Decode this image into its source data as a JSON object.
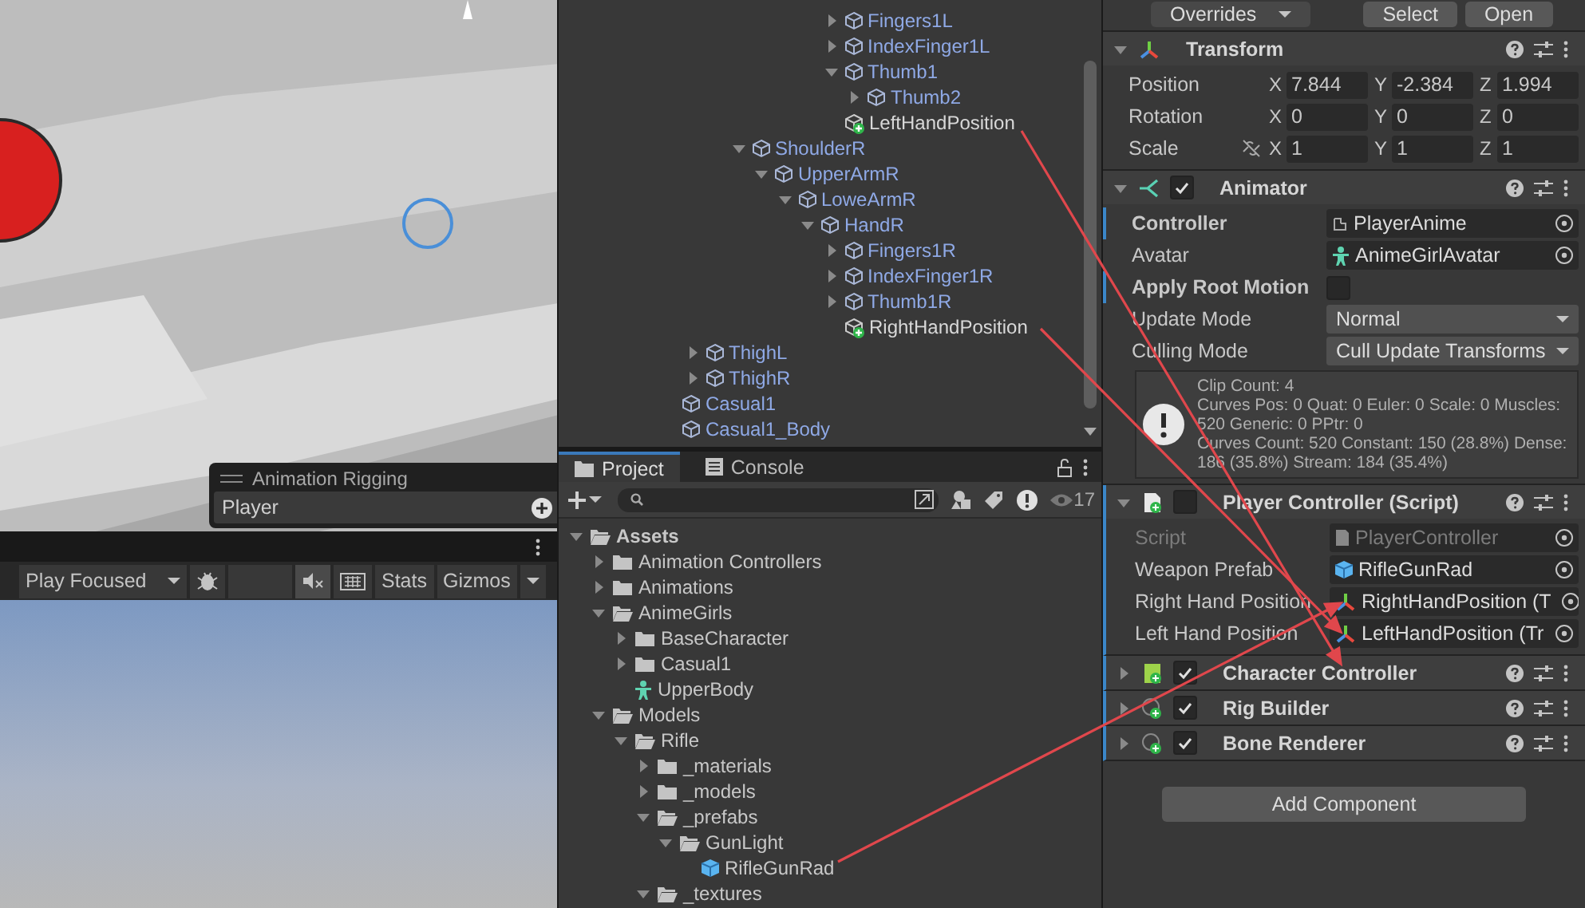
{
  "scene": {
    "overlay": {
      "title": "Animation Rigging",
      "value": "Player"
    }
  },
  "game_toolbar": {
    "play_mode": "Play Focused",
    "stats": "Stats",
    "gizmos": "Gizmos"
  },
  "hierarchy": {
    "items": [
      {
        "children": [
          {
            "children": [
              {
                "children": [
                  {
                    "children": [
                      {
                        "children": [
                          {
                            "children": [
                              {
                                "children": [
                                  {
                                    "label": "Fingers1L",
                                    "kind": "object",
                                    "expanded": false
                                  },
                                  {
                                    "label": "IndexFinger1L",
                                    "kind": "object",
                                    "expanded": false
                                  },
                                  {
                                    "label": "Thumb1",
                                    "kind": "object",
                                    "expanded": true,
                                    "children": [
                                      {
                                        "label": "Thumb2",
                                        "kind": "object",
                                        "expanded": false
                                      }
                                    ]
                                  },
                                  {
                                    "label": "LeftHandPosition",
                                    "kind": "added"
                                  }
                                ]
                              }
                            ]
                          }
                        ]
                      }
                    ]
                  },
                  {
                    "label": "ShoulderR",
                    "kind": "object",
                    "expanded": true,
                    "children": [
                      {
                        "label": "UpperArmR",
                        "kind": "object",
                        "expanded": true,
                        "children": [
                          {
                            "label": "LoweArmR",
                            "kind": "object",
                            "expanded": true,
                            "children": [
                              {
                                "label": "HandR",
                                "kind": "object",
                                "expanded": true,
                                "children": [
                                  {
                                    "label": "Fingers1R",
                                    "kind": "object",
                                    "expanded": false
                                  },
                                  {
                                    "label": "IndexFinger1R",
                                    "kind": "object",
                                    "expanded": false
                                  },
                                  {
                                    "label": "Thumb1R",
                                    "kind": "object",
                                    "expanded": false
                                  },
                                  {
                                    "label": "RightHandPosition",
                                    "kind": "added"
                                  }
                                ]
                              }
                            ]
                          }
                        ]
                      }
                    ]
                  }
                ]
              }
            ]
          },
          {
            "label": "ThighL",
            "kind": "object",
            "expanded": false
          },
          {
            "label": "ThighR",
            "kind": "object",
            "expanded": false
          }
        ]
      },
      {
        "label": "Casual1",
        "kind": "object"
      },
      {
        "label": "Casual1_Body",
        "kind": "object"
      }
    ]
  },
  "project": {
    "tabs": [
      {
        "label": "Project",
        "selected": true
      },
      {
        "label": "Console",
        "selected": false
      }
    ],
    "count": "17",
    "items": [
      {
        "label": "Assets",
        "kind": "folder",
        "expanded": true,
        "children": [
          {
            "label": "Animation Controllers",
            "kind": "folder",
            "expanded": false
          },
          {
            "label": "Animations",
            "kind": "folder",
            "expanded": false
          },
          {
            "label": "AnimeGirls",
            "kind": "folder",
            "expanded": true,
            "children": [
              {
                "label": "BaseCharacter",
                "kind": "folder",
                "expanded": false
              },
              {
                "label": "Casual1",
                "kind": "folder",
                "expanded": false
              },
              {
                "label": "UpperBody",
                "kind": "avatar"
              }
            ]
          },
          {
            "label": "Models",
            "kind": "folder",
            "expanded": true,
            "children": [
              {
                "label": "Rifle",
                "kind": "folder",
                "expanded": true,
                "children": [
                  {
                    "label": "_materials",
                    "kind": "folder",
                    "expanded": false
                  },
                  {
                    "label": "_models",
                    "kind": "folder",
                    "expanded": false
                  },
                  {
                    "label": "_prefabs",
                    "kind": "folder",
                    "expanded": true,
                    "children": [
                      {
                        "label": "GunLight",
                        "kind": "folder",
                        "expanded": true,
                        "children": [
                          {
                            "label": "RifleGunRad",
                            "kind": "prefab"
                          }
                        ]
                      }
                    ]
                  },
                  {
                    "label": "_textures",
                    "kind": "folder",
                    "expanded": true
                  }
                ]
              }
            ]
          }
        ]
      }
    ]
  },
  "inspector": {
    "header_buttons": [
      {
        "label": "Overrides",
        "kind": "dropdown"
      },
      {
        "label": "Select",
        "kind": "button"
      },
      {
        "label": "Open",
        "kind": "button"
      }
    ],
    "components": [
      {
        "title": "Transform",
        "kind": "transform",
        "expanded": true,
        "overridden": false,
        "properties": [
          {
            "label": "Position",
            "kind": "vector",
            "values": [
              {
                "axis": "X",
                "value": "7.844"
              },
              {
                "axis": "Y",
                "value": "-2.384"
              },
              {
                "axis": "Z",
                "value": "1.994"
              }
            ]
          },
          {
            "label": "Rotation",
            "kind": "vector",
            "values": [
              {
                "axis": "X",
                "value": "0"
              },
              {
                "axis": "Y",
                "value": "0"
              },
              {
                "axis": "Z",
                "value": "0"
              }
            ]
          },
          {
            "label": "Scale",
            "kind": "vector",
            "constrained": false,
            "values": [
              {
                "axis": "X",
                "value": "1"
              },
              {
                "axis": "Y",
                "value": "1"
              },
              {
                "axis": "Z",
                "value": "1"
              }
            ]
          }
        ]
      },
      {
        "title": "Animator",
        "kind": "animator",
        "checked": true,
        "expanded": true,
        "overridden": false,
        "properties": [
          {
            "label": "Controller",
            "kind": "controller-ref",
            "value": "PlayerAnime",
            "overridden": true
          },
          {
            "label": "Avatar",
            "kind": "avatar-ref",
            "value": "AnimeGirlAvatar",
            "overridden": false
          },
          {
            "label": "Apply Root Motion",
            "kind": "toggle",
            "checked": false,
            "overridden": true
          },
          {
            "label": "Update Mode",
            "kind": "dropdown",
            "value": "Normal",
            "overridden": false
          },
          {
            "label": "Culling Mode",
            "kind": "dropdown",
            "value": "Cull Update Transforms",
            "overridden": false
          },
          {
            "kind": "info",
            "lines": [
              "Clip Count: 4",
              "Curves Pos: 0 Quat: 0 Euler: 0 Scale: 0 Muscles: 520 Generic: 0 PPtr: 0",
              "Curves Count: 520 Constant: 150 (28.8%) Dense: 186 (35.8%) Stream: 184 (35.4%)"
            ]
          }
        ]
      },
      {
        "title": "Player Controller (Script)",
        "kind": "script",
        "checked": false,
        "expanded": true,
        "overridden": true,
        "properties": [
          {
            "label": "Script",
            "kind": "script-ref",
            "value": "PlayerController",
            "disabled": true
          },
          {
            "label": "Weapon Prefab",
            "kind": "prefab-ref",
            "value": "RifleGunRad"
          },
          {
            "label": "Right Hand Position",
            "kind": "transform-ref",
            "value": "RightHandPosition (T"
          },
          {
            "label": "Left Hand Position",
            "kind": "transform-ref",
            "value": "LeftHandPosition (Tr"
          }
        ]
      },
      {
        "title": "Character Controller",
        "kind": "character",
        "checked": true,
        "expanded": false,
        "overridden": true
      },
      {
        "title": "Rig Builder",
        "kind": "generic",
        "checked": true,
        "expanded": false,
        "overridden": true
      },
      {
        "title": "Bone Renderer",
        "kind": "generic",
        "checked": true,
        "expanded": false,
        "overridden": true
      }
    ],
    "add_button": "Add Component"
  }
}
